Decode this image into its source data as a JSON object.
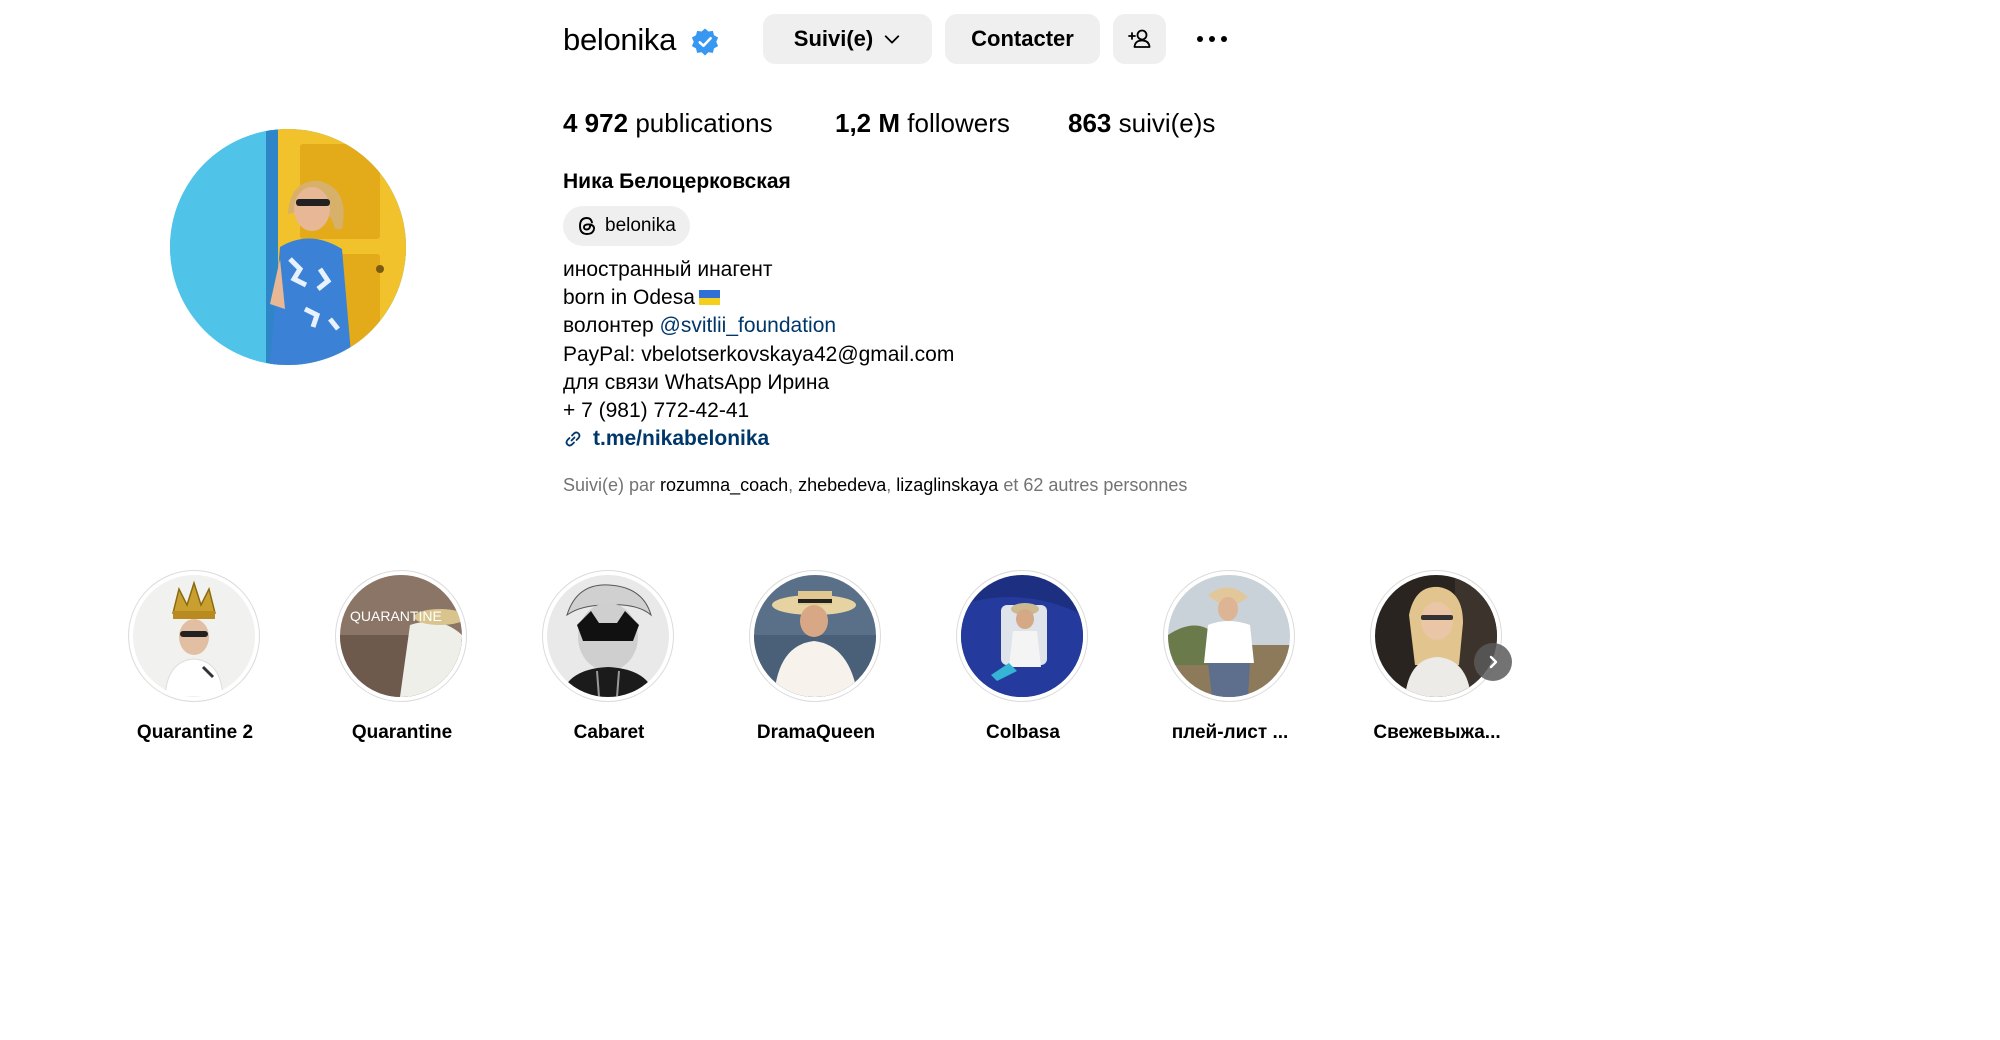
{
  "profile": {
    "username": "belonika",
    "verified_icon": "verified-badge-icon",
    "full_name": "Ника Белоцерковская"
  },
  "buttons": {
    "follow_label": "Suivi(e)",
    "contact_label": "Contacter",
    "suggest_icon": "add-person-icon",
    "more_icon": "more-options-icon"
  },
  "stats": {
    "posts_count": "4 972",
    "posts_label": "publications",
    "followers_count": "1,2 M",
    "followers_label": "followers",
    "following_count": "863",
    "following_label": "suivi(e)s"
  },
  "threads": {
    "handle": "belonika",
    "icon": "threads-icon"
  },
  "bio": {
    "line1": "иностранный инагент",
    "line2": "born in Odesa",
    "line2_flag": "ukraine-flag",
    "line3_prefix": "волонтер",
    "line3_mention": "@svitlii_foundation",
    "line4": "PayPal: vbelotserkovskaya42@gmail.com",
    "line5": "для связи WhatsApp Ирина",
    "line6": "+ 7 (981) 772-42-41",
    "link_icon": "link-icon",
    "link": "t.me/nikabelonika"
  },
  "followed_by": {
    "prefix": "Suivi(e) par",
    "users": [
      "rozumna_coach",
      "zhebedeva",
      "lizaglinskaya"
    ],
    "suffix": "et 62 autres personnes"
  },
  "highlights": [
    {
      "label": "Quarantine 2"
    },
    {
      "label": "Quarantine",
      "cover_text": "QUARANTINE"
    },
    {
      "label": "Cabaret"
    },
    {
      "label": "DramaQueen"
    },
    {
      "label": "Colbasa"
    },
    {
      "label": "плей-лист ..."
    },
    {
      "label": "Свежевыжа..."
    }
  ],
  "colors": {
    "link": "#00376b",
    "verified": "#3897f0",
    "muted": "#737373",
    "button_bg": "#efefef",
    "avatar_blue": "#4fc3e8",
    "avatar_yellow": "#f2c22c"
  }
}
